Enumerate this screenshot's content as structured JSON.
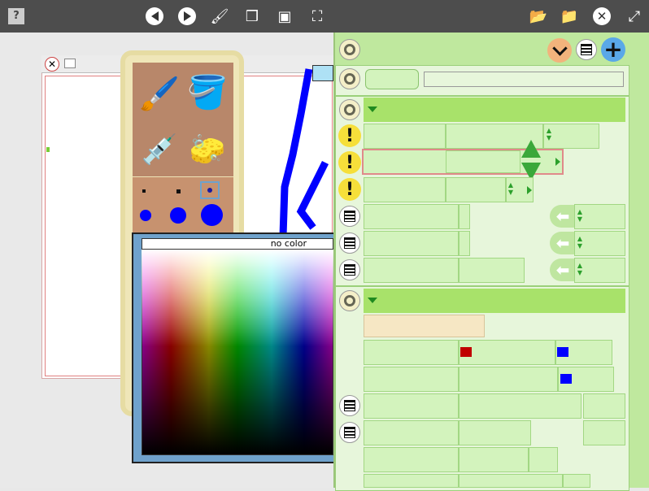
{
  "topbar": {
    "help_icon": "question-icon",
    "nav": [
      "back-icon",
      "forward-icon",
      "paint-brush-icon",
      "package-icon",
      "box-icon",
      "fullscreen-icon"
    ],
    "right": [
      "folder-open-icon",
      "folder-import-icon",
      "close-icon",
      "expand-icon"
    ]
  },
  "paint": {
    "tools": [
      "brush-tool-icon",
      "paint-bucket-icon",
      "eyedropper-icon",
      "eraser-icon"
    ],
    "brush_sizes": 6
  },
  "color_picker": {
    "no_color_label": "no color"
  },
  "inspector": {
    "name_field": "",
    "value_field": "",
    "colors": {
      "swatch_red": "#c00000",
      "swatch_blue1": "#0000ff",
      "swatch_blue2": "#0000ff"
    }
  },
  "colors": {
    "topbar": "#4d4d4d",
    "panel": "#bfe89e",
    "header": "#a8e26a",
    "stroke": "#0000ff"
  }
}
